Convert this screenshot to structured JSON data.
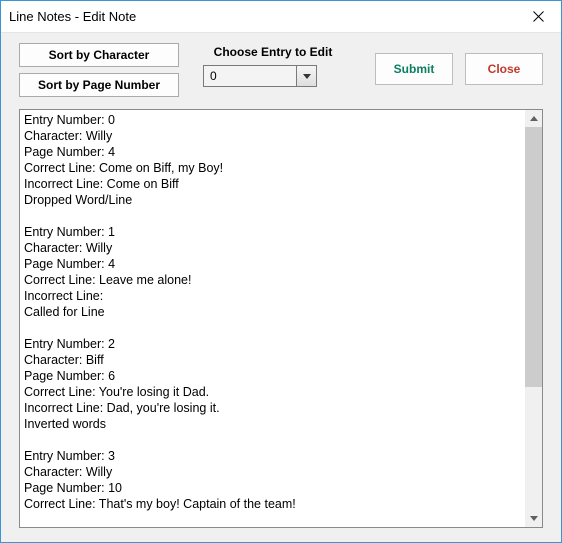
{
  "window": {
    "title": "Line Notes - Edit Note"
  },
  "sort": {
    "by_character": "Sort by Character",
    "by_page": "Sort by Page Number"
  },
  "choose": {
    "label": "Choose Entry to Edit",
    "value": "0"
  },
  "actions": {
    "submit": "Submit",
    "close": "Close"
  },
  "entries_text": "Entry Number: 0\nCharacter: Willy\nPage Number: 4\nCorrect Line: Come on Biff, my Boy!\nIncorrect Line: Come on Biff\nDropped Word/Line\n\nEntry Number: 1\nCharacter: Willy\nPage Number: 4\nCorrect Line: Leave me alone!\nIncorrect Line:\nCalled for Line\n\nEntry Number: 2\nCharacter: Biff\nPage Number: 6\nCorrect Line: You're losing it Dad.\nIncorrect Line: Dad, you're losing it.\nInverted words\n\nEntry Number: 3\nCharacter: Willy\nPage Number: 10\nCorrect Line: That's my boy! Captain of the team!"
}
